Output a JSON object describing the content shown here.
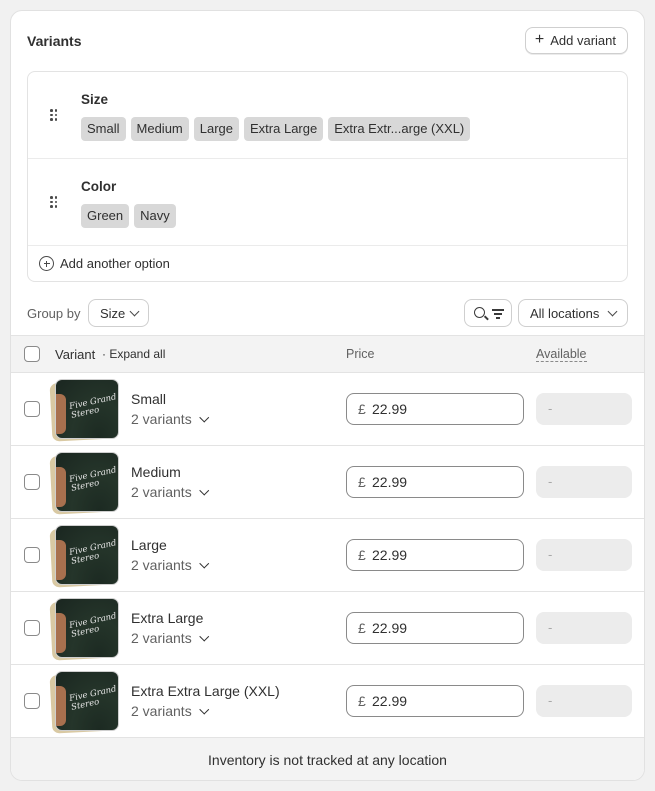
{
  "card": {
    "title": "Variants",
    "add_variant_label": "Add variant"
  },
  "options": [
    {
      "name": "Size",
      "values": [
        "Small",
        "Medium",
        "Large",
        "Extra Large",
        "Extra Extr...arge (XXL)"
      ]
    },
    {
      "name": "Color",
      "values": [
        "Green",
        "Navy"
      ]
    }
  ],
  "add_option_label": "Add another option",
  "toolbar": {
    "group_by_label": "Group by",
    "group_by_value": "Size",
    "location_filter": "All locations"
  },
  "table": {
    "columns": {
      "variant": "Variant",
      "expand_all": "· Expand all",
      "price": "Price",
      "available": "Available"
    },
    "rows": [
      {
        "title": "Small",
        "subtitle": "2 variants",
        "currency": "£",
        "price": "22.99",
        "available": "-"
      },
      {
        "title": "Medium",
        "subtitle": "2 variants",
        "currency": "£",
        "price": "22.99",
        "available": "-"
      },
      {
        "title": "Large",
        "subtitle": "2 variants",
        "currency": "£",
        "price": "22.99",
        "available": "-"
      },
      {
        "title": "Extra Large",
        "subtitle": "2 variants",
        "currency": "£",
        "price": "22.99",
        "available": "-"
      },
      {
        "title": "Extra Extra Large (XXL)",
        "subtitle": "2 variants",
        "currency": "£",
        "price": "22.99",
        "available": "-"
      }
    ]
  },
  "thumbnail_print": [
    "Five Grand",
    "Stereo"
  ],
  "footer_text": "Inventory is not tracked at any location",
  "colors": {
    "chip_bg": "#d8d8d8",
    "header_bg": "#f3f3f3",
    "card_bg": "#ffffff",
    "text": "#303030",
    "muted": "#616161"
  }
}
